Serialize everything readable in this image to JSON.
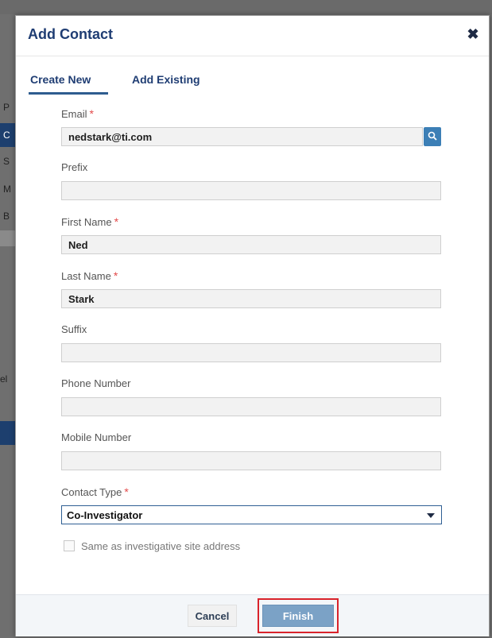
{
  "background": {
    "letters": [
      "P",
      "C",
      "S",
      "M",
      "B",
      "el"
    ]
  },
  "modal": {
    "title": "Add Contact",
    "close_icon": "close-icon"
  },
  "tabs": [
    {
      "label": "Create New",
      "active": true
    },
    {
      "label": "Add Existing",
      "active": false
    }
  ],
  "form": {
    "email": {
      "label": "Email",
      "required": "*",
      "value": "nedstark@ti.com"
    },
    "prefix": {
      "label": "Prefix",
      "value": ""
    },
    "first_name": {
      "label": "First Name",
      "required": "*",
      "value": "Ned"
    },
    "last_name": {
      "label": "Last Name",
      "required": "*",
      "value": "Stark"
    },
    "suffix": {
      "label": "Suffix",
      "value": ""
    },
    "phone": {
      "label": "Phone Number",
      "value": ""
    },
    "mobile": {
      "label": "Mobile Number",
      "value": ""
    },
    "contact_type": {
      "label": "Contact Type",
      "required": "*",
      "value": "Co-Investigator"
    },
    "same_address": {
      "label": "Same as investigative site address",
      "checked": false
    }
  },
  "footer": {
    "cancel_label": "Cancel",
    "finish_label": "Finish"
  },
  "colors": {
    "title": "#1f3d73",
    "accent": "#3c7fb6",
    "required": "#e34a4a",
    "highlight": "#d9232b"
  }
}
